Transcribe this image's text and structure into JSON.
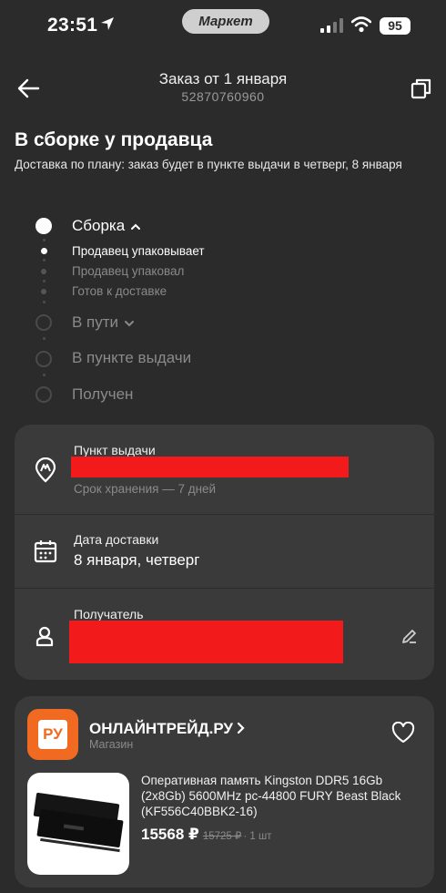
{
  "status_bar": {
    "time": "23:51",
    "app_badge": "Маркет",
    "battery": "95"
  },
  "header": {
    "title": "Заказ от 1 января",
    "order_number": "52870760960"
  },
  "status": {
    "title": "В сборке у продавца",
    "description": "Доставка по плану: заказ будет в пункте выдачи в четверг, 8 января"
  },
  "timeline": {
    "stage_assembly": "Сборка",
    "sub_packing": "Продавец упаковывает",
    "sub_packed": "Продавец упаковал",
    "sub_ready": "Готов к доставке",
    "stage_transit": "В пути",
    "stage_pickup_point": "В пункте выдачи",
    "stage_received": "Получен"
  },
  "delivery_info": {
    "pickup_label": "Пункт выдачи",
    "storage_note": "Срок хранения — 7 дней",
    "date_label": "Дата доставки",
    "date_value": "8 января, четверг",
    "recipient_label": "Получатель"
  },
  "store": {
    "logo_text": "РУ",
    "name": "ОНЛАЙНТРЕЙД.РУ",
    "type": "Магазин"
  },
  "product": {
    "title": "Оперативная память Kingston DDR5 16Gb (2x8Gb) 5600MHz pc-44800 FURY Beast Black (KF556C40BBK2-16)",
    "price": "15568 ₽",
    "old_price": "15725 ₽",
    "quantity": "· 1 шт"
  },
  "colors": {
    "background": "#2b2b2b",
    "card": "#3a3a3a",
    "redaction": "#f21a1a",
    "store_logo": "#f06a21"
  }
}
